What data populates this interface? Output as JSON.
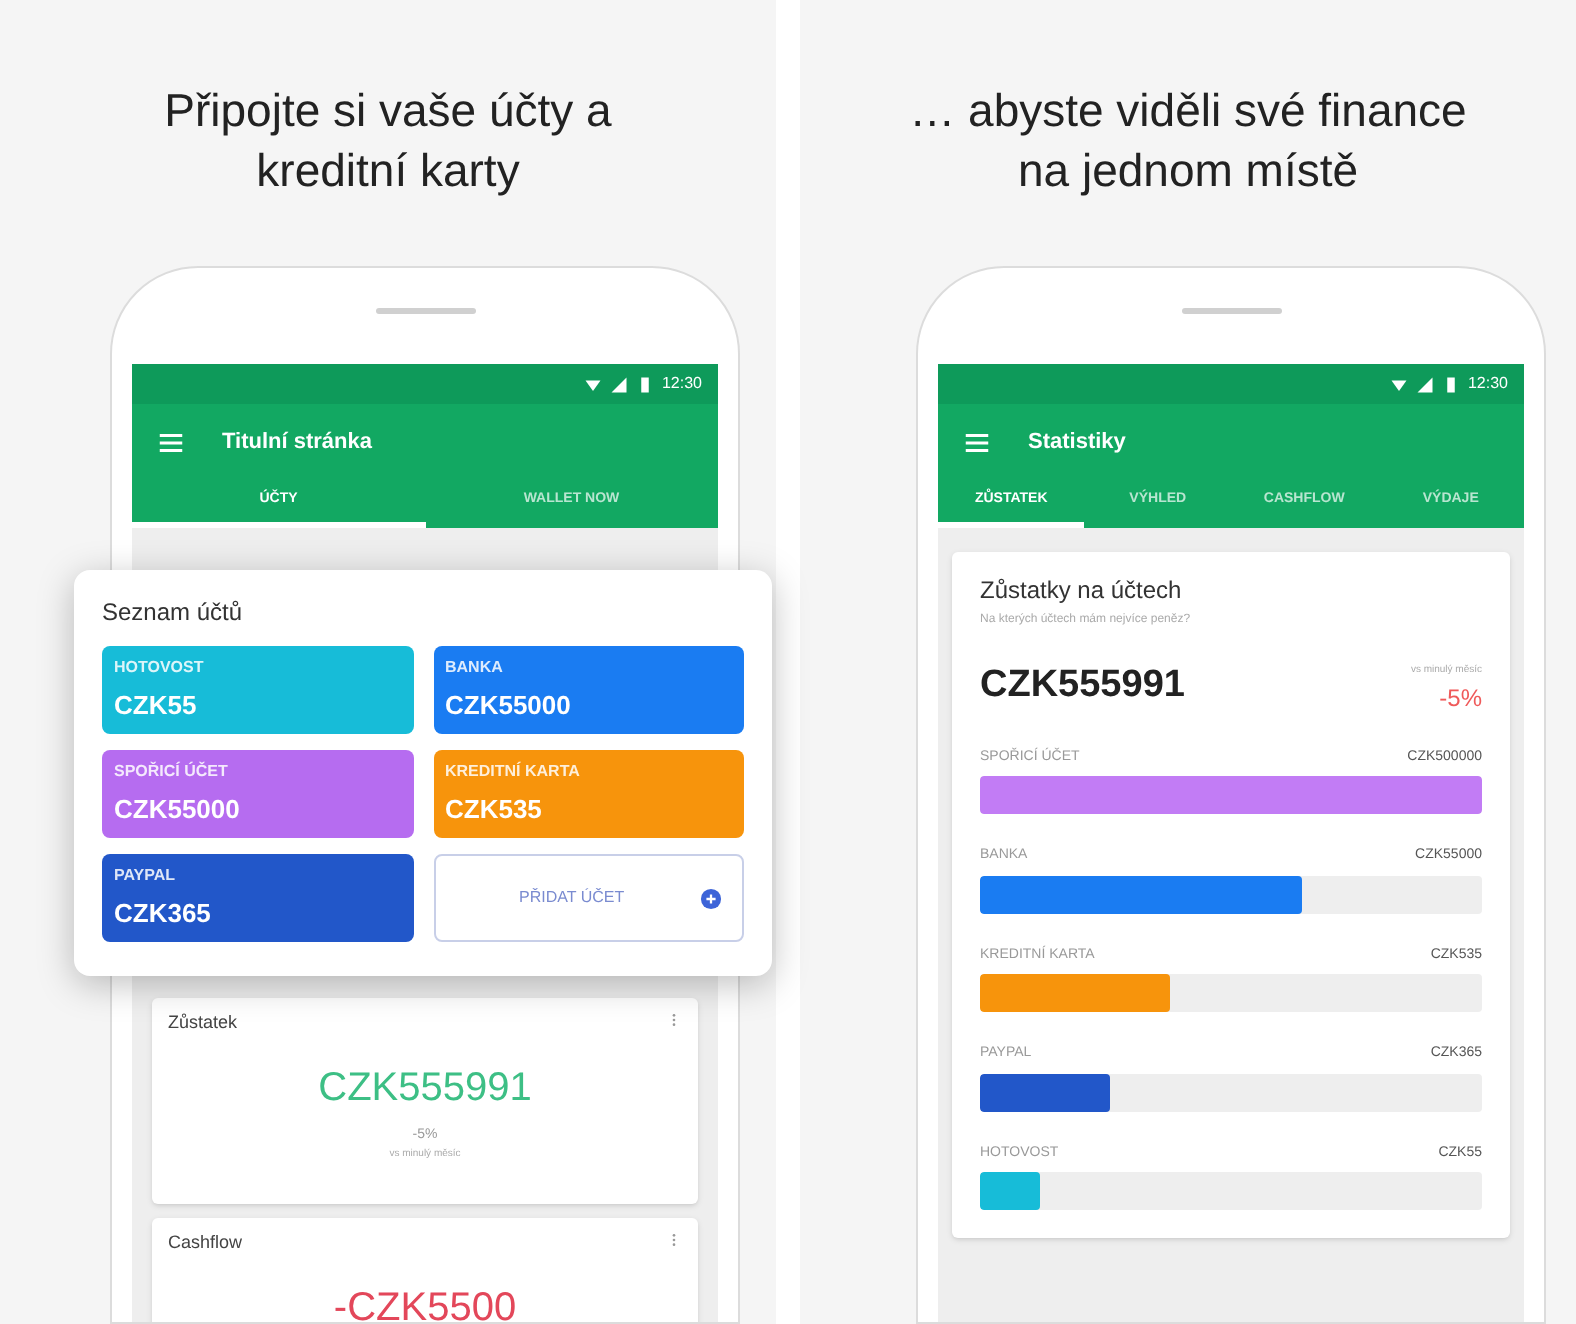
{
  "left_screen": {
    "headline": "Připojte si vaše účty a kreditní karty",
    "status_bar": {
      "time": "12:30"
    },
    "app_bar": {
      "title": "Titulní stránka"
    },
    "tabs": [
      {
        "label": "ÚČTY",
        "selected": true
      },
      {
        "label": "WALLET NOW",
        "selected": false
      }
    ],
    "account_list": {
      "title": "Seznam účtů",
      "items": [
        {
          "kind": "account",
          "label": "HOTOVOST",
          "amount": "CZK55",
          "color": "#17bcd8"
        },
        {
          "kind": "account",
          "label": "BANKA",
          "amount": "CZK55000",
          "color": "#1a7cf2"
        },
        {
          "kind": "account",
          "label": "SPOŘICÍ ÚČET",
          "amount": "CZK55000",
          "color": "#b66cf0"
        },
        {
          "kind": "account",
          "label": "KREDITNÍ KARTA",
          "amount": "CZK535",
          "color": "#f7940c"
        },
        {
          "kind": "account",
          "label": "PAYPAL",
          "amount": "CZK365",
          "color": "#2257c9"
        },
        {
          "kind": "add",
          "label": "PŘIDAT ÚČET"
        }
      ]
    },
    "cards": [
      {
        "title": "Zůstatek",
        "value": "CZK555991",
        "color": "#3dbf85",
        "change": "-5%",
        "note": "vs minulý měsíc"
      },
      {
        "title": "Cashflow",
        "value": "-CZK5500",
        "color": "#e3475a"
      }
    ]
  },
  "right_screen": {
    "headline": "… abyste viděli své finance na jednom místě",
    "status_bar": {
      "time": "12:30"
    },
    "app_bar": {
      "title": "Statistiky"
    },
    "tabs": [
      {
        "label": "ZŮSTATEK",
        "selected": true
      },
      {
        "label": "VÝHLED",
        "selected": false
      },
      {
        "label": "CASHFLOW",
        "selected": false
      },
      {
        "label": "VÝDAJE",
        "selected": false
      }
    ],
    "card": {
      "title": "Zůstatky na účtech",
      "subtitle": "Na kterých účtech mám nejvíce peněz?",
      "total": "CZK555991",
      "note": "vs minulý měsíc",
      "change": "-5%",
      "rows": [
        {
          "label": "SPOŘICÍ ÚČET",
          "amount": "CZK500000",
          "level": 1,
          "color": "#c27cf5"
        },
        {
          "label": "BANKA",
          "amount": "CZK55000",
          "level": 0.64,
          "color": "#1a7cf2"
        },
        {
          "label": "KREDITNÍ KARTA",
          "amount": "CZK535",
          "level": 0.38,
          "color": "#f7940c"
        },
        {
          "label": "PAYPAL",
          "amount": "CZK365",
          "level": 0.26,
          "color": "#2257c9"
        },
        {
          "label": "HOTOVOST",
          "amount": "CZK55",
          "level": 0.12,
          "color": "#17bcd8"
        }
      ]
    }
  }
}
